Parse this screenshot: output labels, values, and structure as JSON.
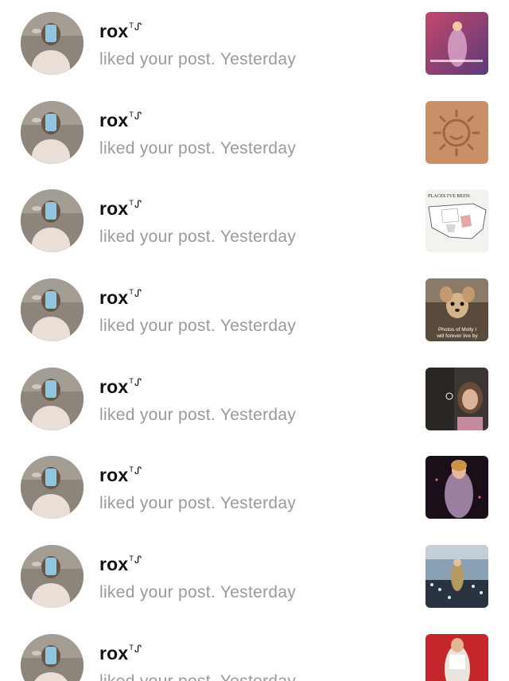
{
  "notifications": [
    {
      "username": "rox",
      "badge": "ᵀᔑ",
      "action": "liked your post.",
      "time": "Yesterday",
      "thumb_caption": ""
    },
    {
      "username": "rox",
      "badge": "ᵀᔑ",
      "action": "liked your post.",
      "time": "Yesterday",
      "thumb_caption": ""
    },
    {
      "username": "rox",
      "badge": "ᵀᔑ",
      "action": "liked your post.",
      "time": "Yesterday",
      "thumb_caption": "PLACES I'VE BEEN:"
    },
    {
      "username": "rox",
      "badge": "ᵀᔑ",
      "action": "liked your post.",
      "time": "Yesterday",
      "thumb_caption": "Photos of Molly I will forever live by"
    },
    {
      "username": "rox",
      "badge": "ᵀᔑ",
      "action": "liked your post.",
      "time": "Yesterday",
      "thumb_caption": ""
    },
    {
      "username": "rox",
      "badge": "ᵀᔑ",
      "action": "liked your post.",
      "time": "Yesterday",
      "thumb_caption": ""
    },
    {
      "username": "rox",
      "badge": "ᵀᔑ",
      "action": "liked your post.",
      "time": "Yesterday",
      "thumb_caption": ""
    },
    {
      "username": "rox",
      "badge": "ᵀᔑ",
      "action": "liked your post.",
      "time": "Yesterday",
      "thumb_caption": ""
    }
  ],
  "colors": {
    "username": "#111111",
    "secondary_text": "#9a9a9a",
    "background": "#ffffff"
  }
}
